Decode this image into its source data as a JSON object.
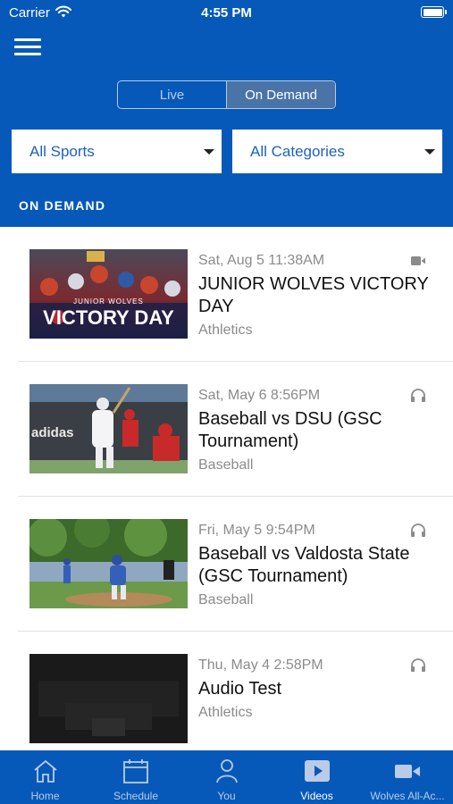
{
  "status_bar": {
    "carrier": "Carrier",
    "time": "4:55 PM"
  },
  "segment": {
    "live_label": "Live",
    "on_demand_label": "On Demand",
    "selected": "On Demand"
  },
  "filters": {
    "sports": "All Sports",
    "categories": "All Categories"
  },
  "section_title": "ON DEMAND",
  "items": [
    {
      "date": "Sat, Aug 5 11:38AM",
      "title": "JUNIOR WOLVES VICTORY DAY",
      "category": "Athletics",
      "media": "video-icon",
      "thumb_label": "VICTORY DAY",
      "thumb_sub": "JUNIOR WOLVES"
    },
    {
      "date": "Sat, May 6 8:56PM",
      "title": "Baseball vs DSU (GSC Tournament)",
      "category": "Baseball",
      "media": "headphones-icon",
      "thumb_label": "adidas"
    },
    {
      "date": "Fri, May 5 9:54PM",
      "title": "Baseball vs Valdosta State (GSC Tournament)",
      "category": "Baseball",
      "media": "headphones-icon"
    },
    {
      "date": "Thu, May 4 2:58PM",
      "title": "Audio Test",
      "category": "Athletics",
      "media": "headphones-icon"
    }
  ],
  "tabs": [
    {
      "label": "Home",
      "icon": "home-icon"
    },
    {
      "label": "Schedule",
      "icon": "calendar-icon"
    },
    {
      "label": "You",
      "icon": "person-icon"
    },
    {
      "label": "Videos",
      "icon": "play-icon",
      "active": true
    },
    {
      "label": "Wolves All-Ac...",
      "icon": "camera-icon"
    }
  ],
  "colors": {
    "brand_blue": "#0659b8",
    "segment_selected": "#4a74a7",
    "dropdown_text": "#1d63bb"
  }
}
